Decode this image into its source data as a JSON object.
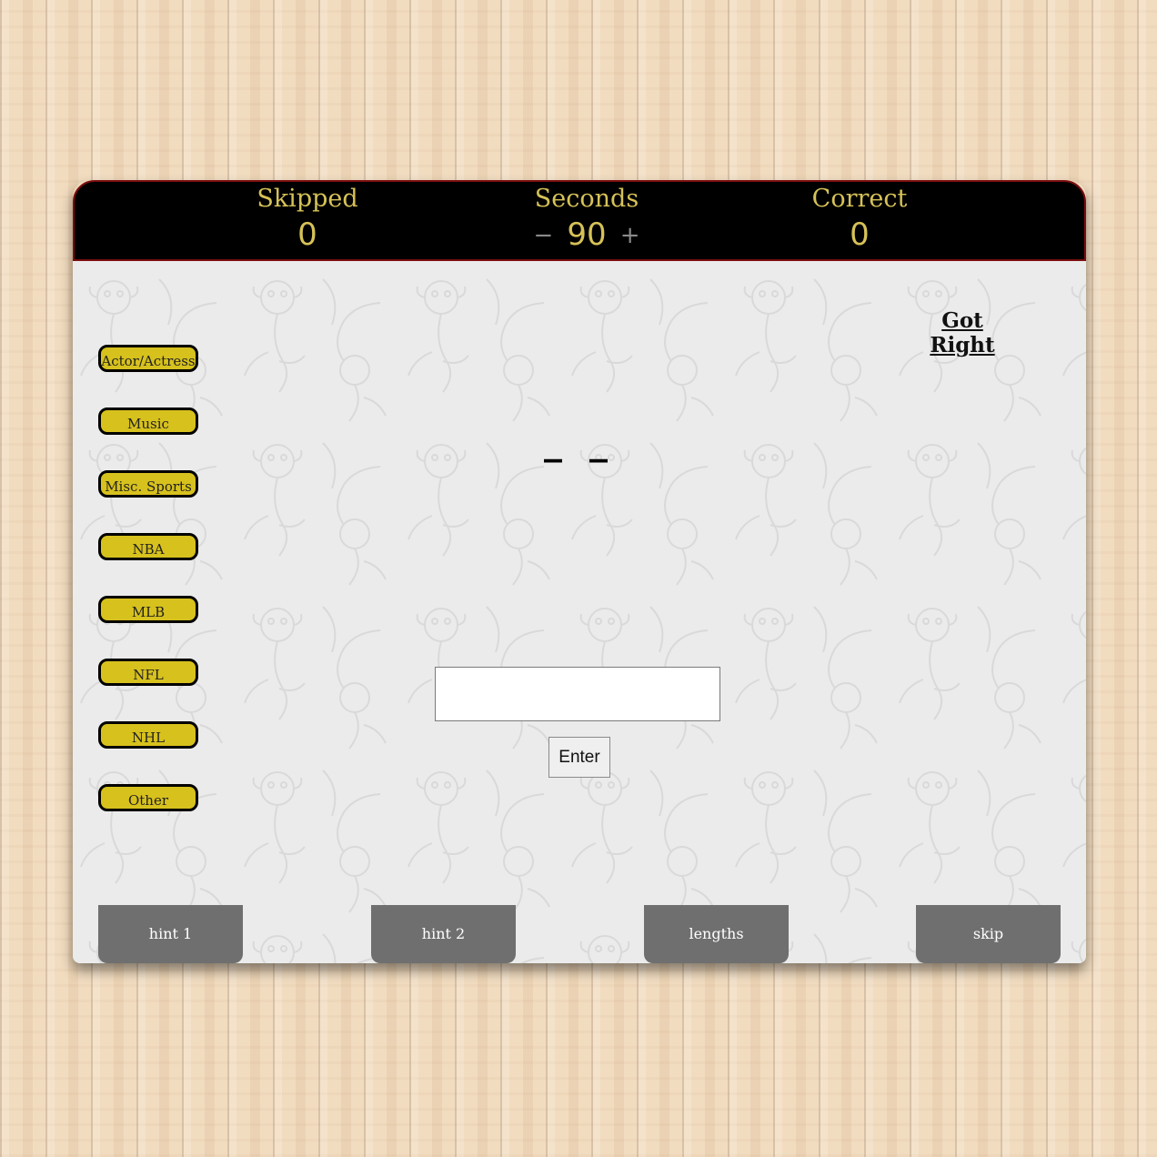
{
  "scoreboard": {
    "skipped_label": "Skipped",
    "skipped_value": "0",
    "seconds_label": "Seconds",
    "seconds_value": "90",
    "seconds_minus": "−",
    "seconds_plus": "+",
    "correct_label": "Correct",
    "correct_value": "0"
  },
  "got_right": "Got Right",
  "categories": [
    "Actor/Actress",
    "Music",
    "Misc. Sports",
    "NBA",
    "MLB",
    "NFL",
    "NHL",
    "Other"
  ],
  "blanks": "_ _",
  "answer": {
    "value": "",
    "placeholder": ""
  },
  "enter_label": "Enter",
  "tabs": {
    "hint1": "hint 1",
    "hint2": "hint 2",
    "lengths": "lengths",
    "skip": "skip"
  },
  "colors": {
    "scoreboard_text": "#d6c257",
    "scoreboard_border": "#7b0e10",
    "category_fill": "#d7c11d",
    "tab_fill": "#6f6f6f",
    "board": "#ebebeb"
  }
}
